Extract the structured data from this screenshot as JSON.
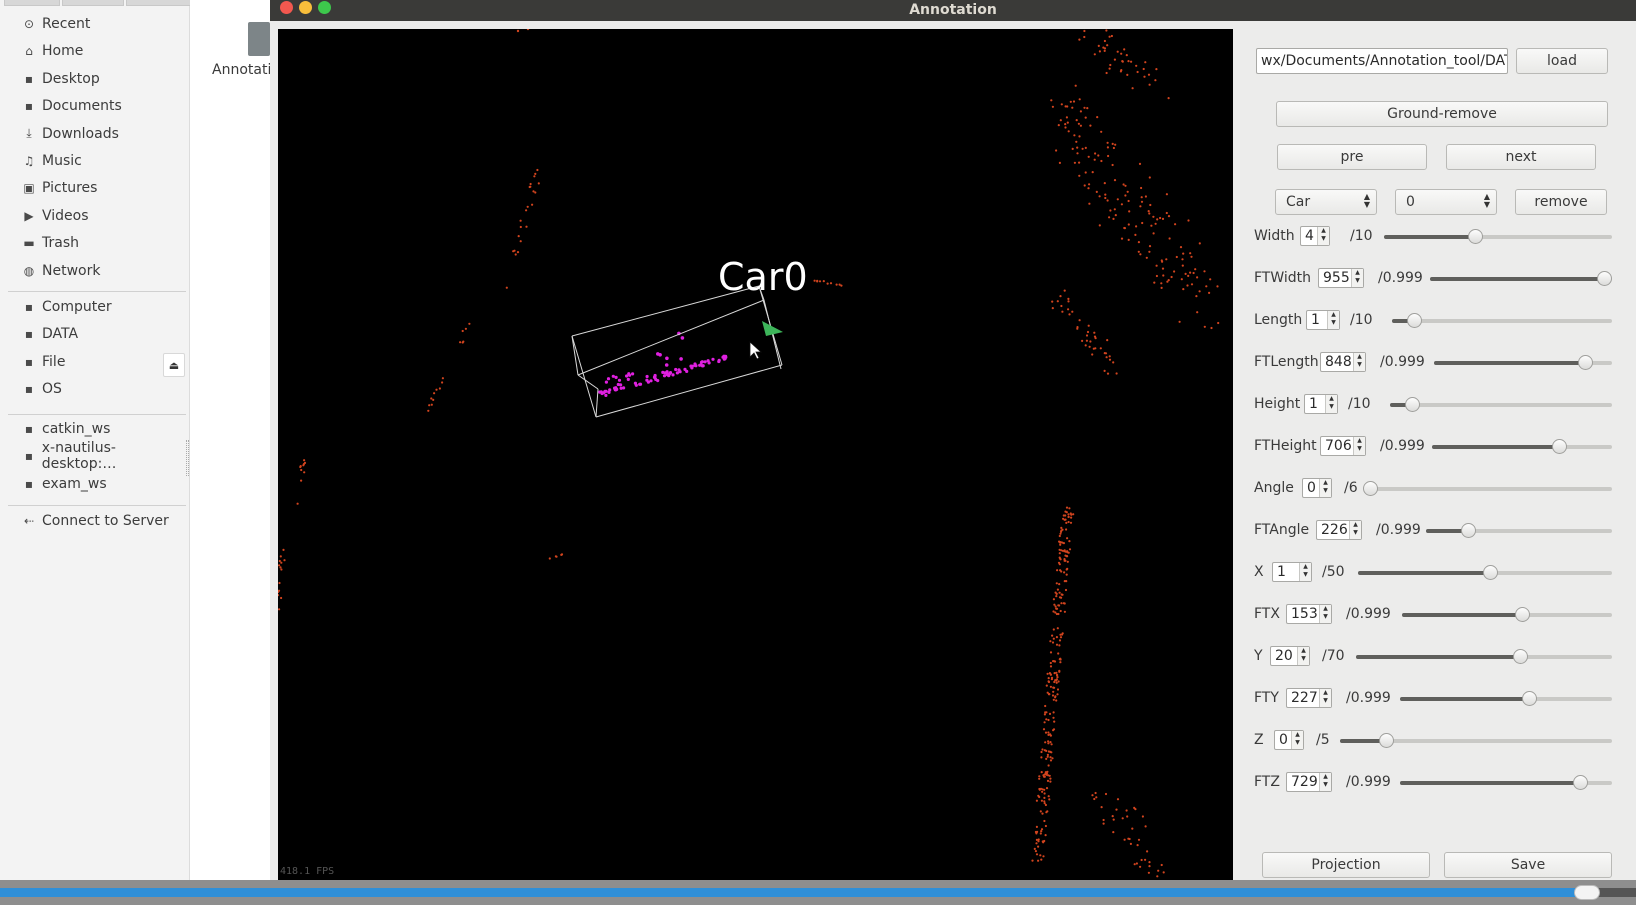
{
  "file_manager": {
    "sidebar": {
      "places": [
        {
          "label": "Recent",
          "icon": "clock-icon"
        },
        {
          "label": "Home",
          "icon": "home-icon"
        },
        {
          "label": "Desktop",
          "icon": "folder-icon"
        },
        {
          "label": "Documents",
          "icon": "folder-icon"
        },
        {
          "label": "Downloads",
          "icon": "download-icon"
        },
        {
          "label": "Music",
          "icon": "music-icon"
        },
        {
          "label": "Pictures",
          "icon": "picture-icon"
        },
        {
          "label": "Videos",
          "icon": "video-icon"
        },
        {
          "label": "Trash",
          "icon": "trash-icon"
        },
        {
          "label": "Network",
          "icon": "network-icon"
        }
      ],
      "devices": [
        {
          "label": "Computer",
          "icon": "drive-icon"
        },
        {
          "label": "DATA",
          "icon": "drive-icon"
        },
        {
          "label": "File",
          "icon": "drive-icon"
        },
        {
          "label": "OS",
          "icon": "drive-icon"
        }
      ],
      "bookmarks": [
        {
          "label": "catkin_ws",
          "icon": "folder-icon"
        },
        {
          "label": "x-nautilus-desktop:…",
          "icon": "bookmark-icon"
        },
        {
          "label": "exam_ws",
          "icon": "folder-icon"
        }
      ],
      "connect_label": "Connect to Server",
      "eject_icon": "eject-icon"
    },
    "content": {
      "folder_label": "Annotati"
    }
  },
  "annotation": {
    "window_title": "Annotation",
    "viewer": {
      "object_label": "Car0",
      "fps_text": "418.1 FPS"
    },
    "path_input": "wx/Documents/Annotation_tool/DATA",
    "load_label": "load",
    "ground_remove_label": "Ground-remove",
    "pre_label": "pre",
    "next_label": "next",
    "class_select": "Car",
    "id_select": "0",
    "remove_label": "remove",
    "params": [
      {
        "label": "Width",
        "value": "4",
        "max_label": "/10",
        "fraction": 0.4
      },
      {
        "label": "FTWidth",
        "value": "955",
        "max_label": "/0.999",
        "fraction": 0.955
      },
      {
        "label": "Length",
        "value": "1",
        "max_label": "/10",
        "fraction": 0.1
      },
      {
        "label": "FTLength",
        "value": "848",
        "max_label": "/0.999",
        "fraction": 0.848
      },
      {
        "label": "Height",
        "value": "1",
        "max_label": "/10",
        "fraction": 0.1
      },
      {
        "label": "FTHeight",
        "value": "706",
        "max_label": "/0.999",
        "fraction": 0.706
      },
      {
        "label": "Angle",
        "value": "0",
        "max_label": "/6",
        "fraction": 0.0
      },
      {
        "label": "FTAngle",
        "value": "226",
        "max_label": "/0.999",
        "fraction": 0.226
      },
      {
        "label": "X",
        "value": "1",
        "max_label": "/50",
        "fraction": 0.52
      },
      {
        "label": "FTX",
        "value": "153",
        "max_label": "/0.999",
        "fraction": 0.57
      },
      {
        "label": "Y",
        "value": "20",
        "max_label": "/70",
        "fraction": 0.64
      },
      {
        "label": "FTY",
        "value": "227",
        "max_label": "/0.999",
        "fraction": 0.61
      },
      {
        "label": "Z",
        "value": "0",
        "max_label": "/5",
        "fraction": 0.17
      },
      {
        "label": "FTZ",
        "value": "729",
        "max_label": "/0.999",
        "fraction": 0.85
      }
    ],
    "projection_label": "Projection",
    "save_label": "Save"
  },
  "playback": {
    "progress_fraction": 0.97,
    "accent_color": "#2f8fd8"
  },
  "colors": {
    "points": "#d2441e",
    "selected_points": "#e020e0",
    "heading_marker": "#3db55a"
  }
}
